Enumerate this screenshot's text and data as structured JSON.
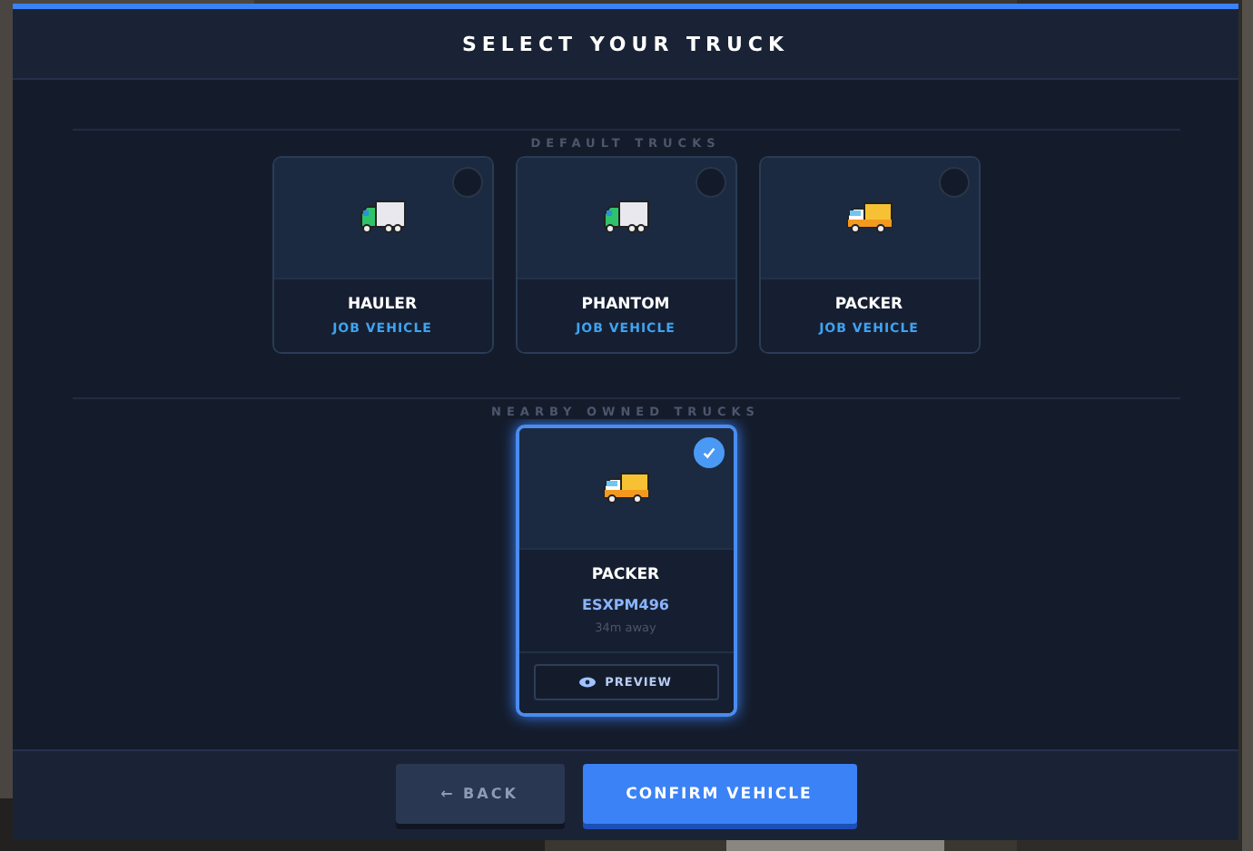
{
  "title": "SELECT YOUR TRUCK",
  "sections": [
    {
      "label": "DEFAULT TRUCKS",
      "trucks": [
        {
          "name": "HAULER",
          "kind": "box-truck",
          "subtitle": "JOB VEHICLE",
          "selected": false
        },
        {
          "name": "PHANTOM",
          "kind": "box-truck",
          "subtitle": "JOB VEHICLE",
          "selected": false
        },
        {
          "name": "PACKER",
          "kind": "van",
          "subtitle": "JOB VEHICLE",
          "selected": false
        }
      ]
    },
    {
      "label": "NEARBY OWNED TRUCKS",
      "trucks": [
        {
          "name": "PACKER",
          "kind": "van",
          "plate": "ESXPM496",
          "distance": "34m away",
          "preview": "PREVIEW",
          "selected": true
        }
      ]
    }
  ],
  "buttons": {
    "back": "← BACK",
    "confirm": "CONFIRM VEHICLE"
  }
}
